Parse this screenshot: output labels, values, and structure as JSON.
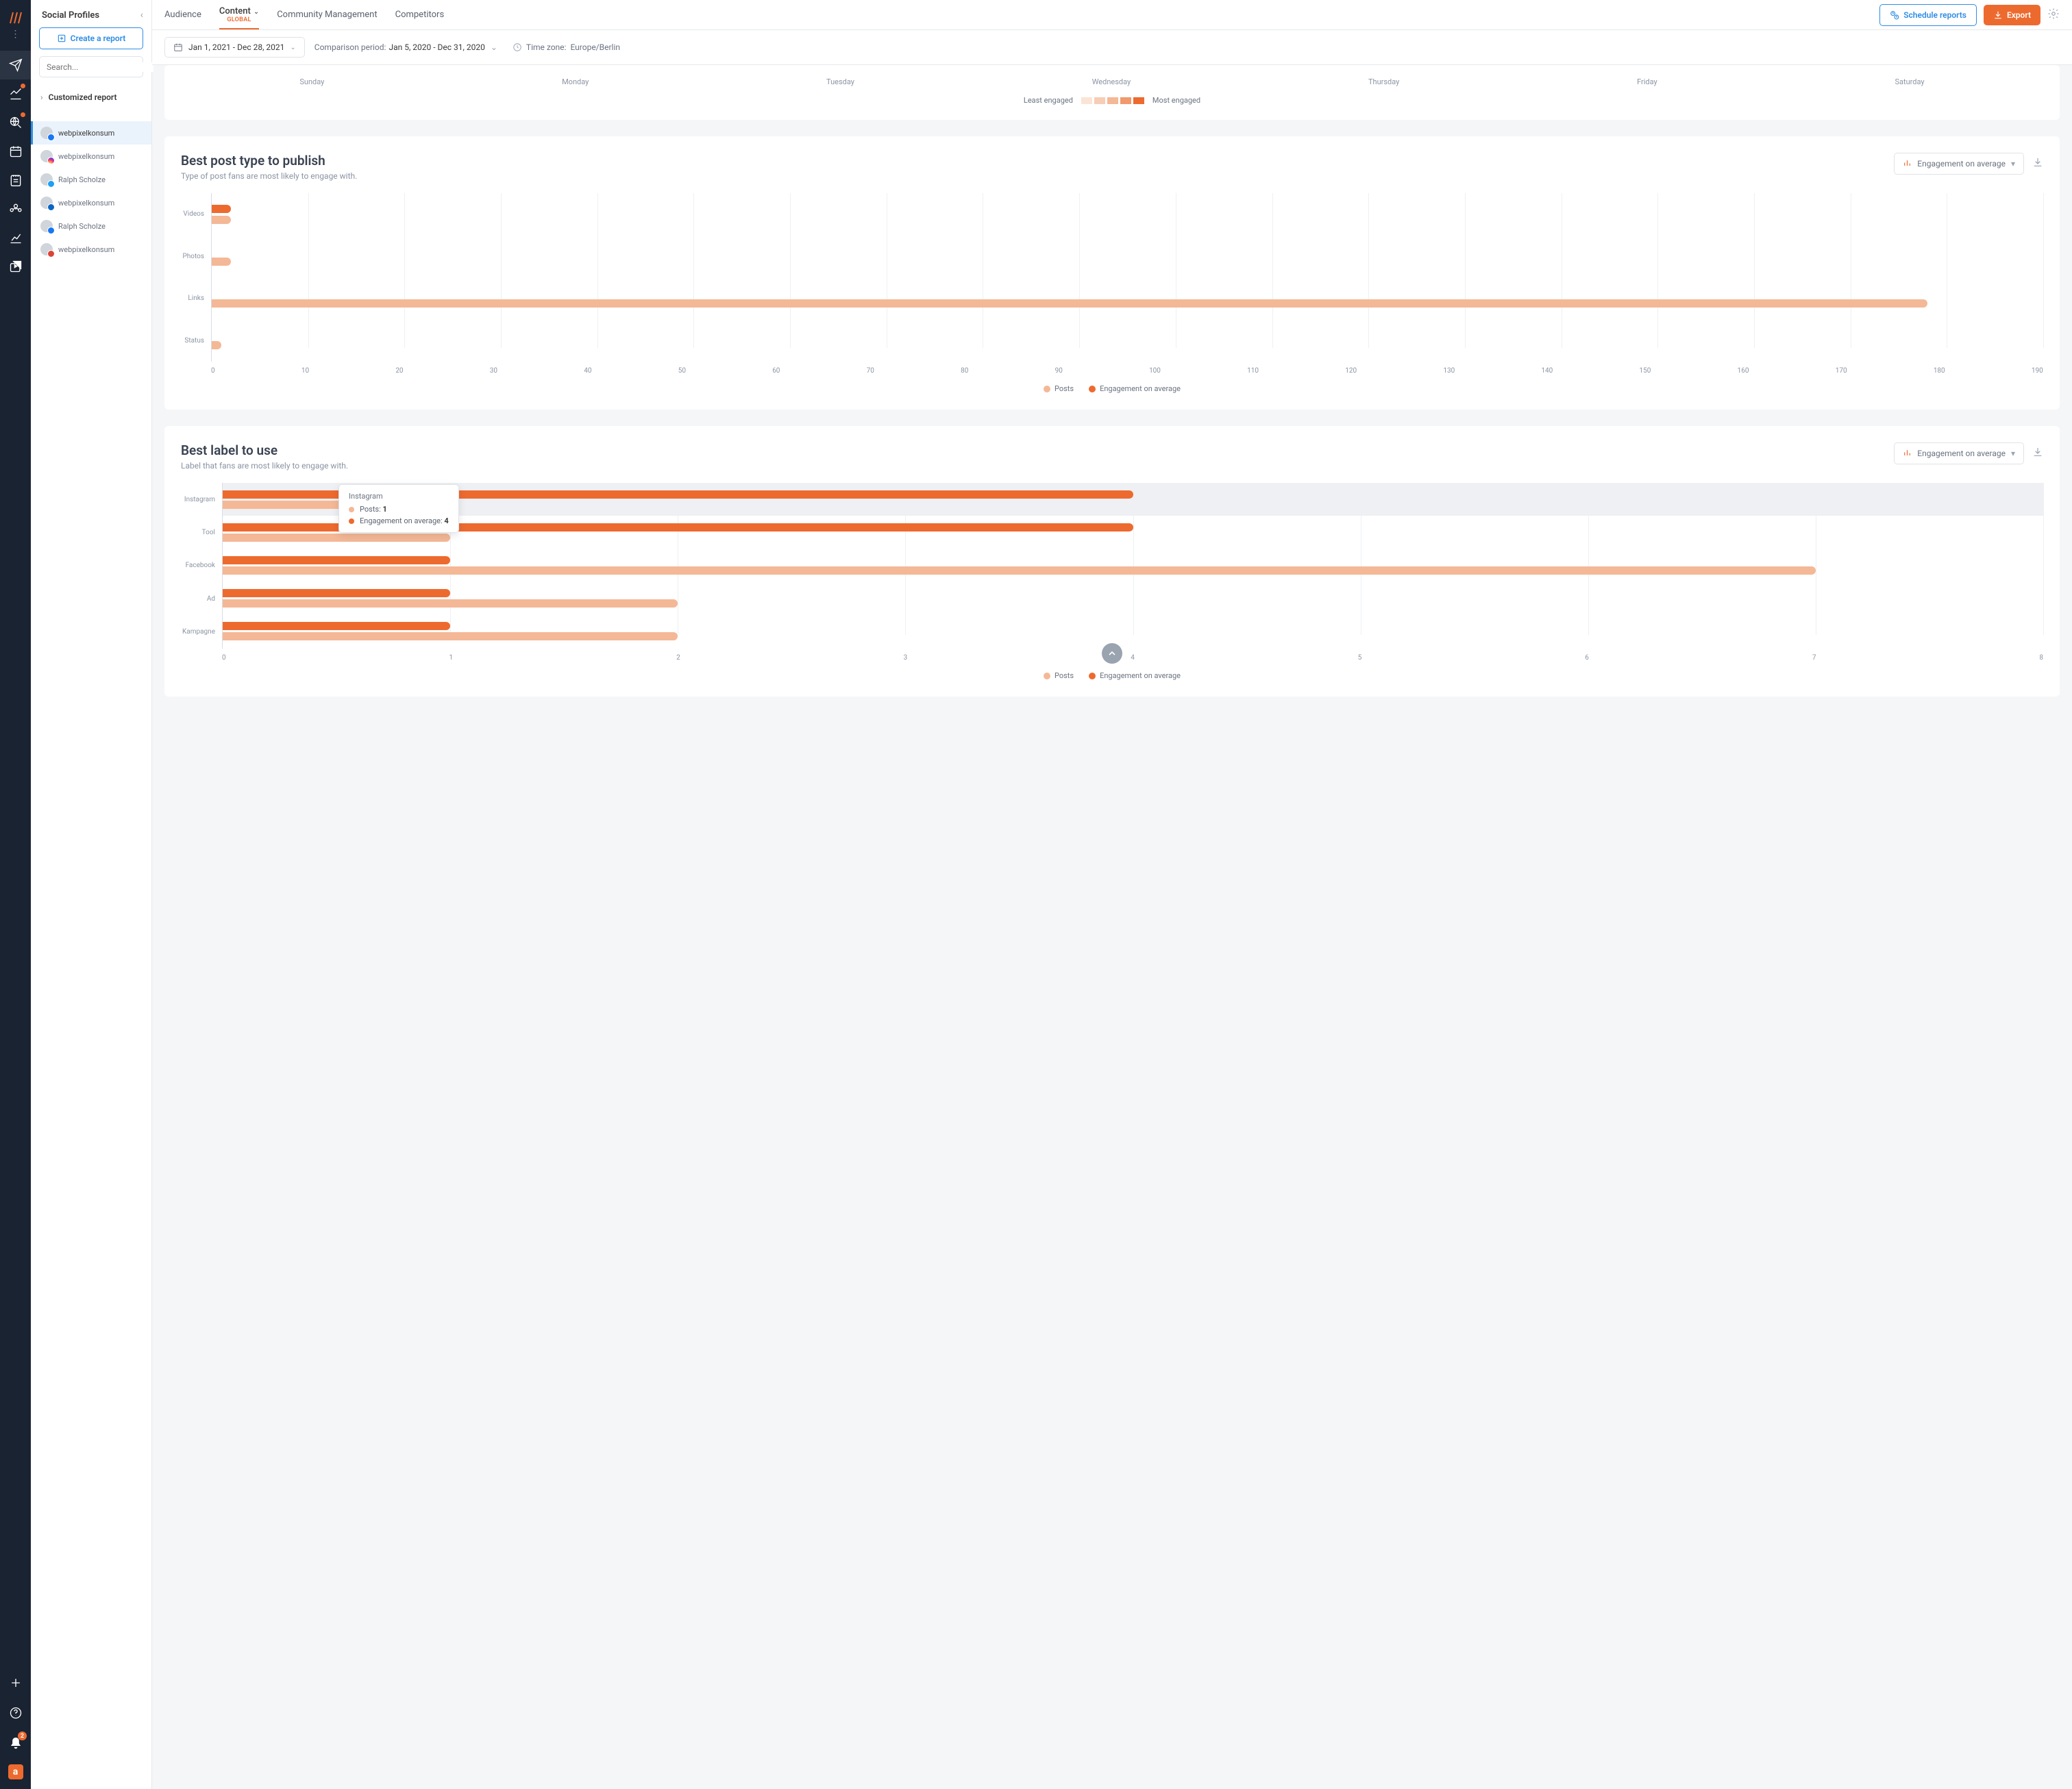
{
  "sidebar": {
    "title": "Social Profiles",
    "create": "Create a report",
    "search_placeholder": "Search...",
    "customized": "Customized report",
    "profiles": [
      {
        "name": "webpixelkonsum",
        "net": "fb",
        "active": true
      },
      {
        "name": "webpixelkonsum",
        "net": "ig"
      },
      {
        "name": "Ralph Scholze",
        "net": "tw"
      },
      {
        "name": "webpixelkonsum",
        "net": "li"
      },
      {
        "name": "Ralph Scholze",
        "net": "fp"
      },
      {
        "name": "webpixelkonsum",
        "net": "gp"
      }
    ]
  },
  "tabs": {
    "audience": "Audience",
    "content": "Content",
    "content_sub": "Global",
    "community": "Community Management",
    "competitors": "Competitors"
  },
  "actions": {
    "schedule": "Schedule reports",
    "export": "Export"
  },
  "filters": {
    "date_range": "Jan 1, 2021 - Dec 28, 2021",
    "comp_label": "Comparison period:",
    "comp_value": "Jan 5, 2020 - Dec 31, 2020",
    "tz_label": "Time zone:",
    "tz_value": "Europe/Berlin"
  },
  "days": [
    "Sunday",
    "Monday",
    "Tuesday",
    "Wednesday",
    "Thursday",
    "Friday",
    "Saturday"
  ],
  "heat_legend": {
    "least": "Least engaged",
    "most": "Most engaged",
    "colors": [
      "#fbe4d6",
      "#f7cdb5",
      "#f4b896",
      "#f09a6d",
      "#ed6a2f"
    ]
  },
  "rail_notifications": "2",
  "card1": {
    "title": "Best post type to publish",
    "subtitle": "Type of post fans are most likely to engage with.",
    "dropdown": "Engagement on average",
    "legend_posts": "Posts",
    "legend_eng": "Engagement on average"
  },
  "card2": {
    "title": "Best label to use",
    "subtitle": "Label that fans are most likely to engage with.",
    "dropdown": "Engagement on average",
    "legend_posts": "Posts",
    "legend_eng": "Engagement on average"
  },
  "tooltip": {
    "title": "Instagram",
    "row1_label": "Posts:",
    "row1_val": "1",
    "row2_label": "Engagement on average:",
    "row2_val": "4"
  },
  "chart_data": [
    {
      "type": "bar",
      "title": "Best post type to publish",
      "orientation": "horizontal",
      "categories": [
        "Videos",
        "Photos",
        "Links",
        "Status"
      ],
      "series": [
        {
          "name": "Posts",
          "values": [
            2,
            2,
            178,
            1
          ]
        },
        {
          "name": "Engagement on average",
          "values": [
            2,
            0,
            0,
            0
          ]
        }
      ],
      "xlabel": "",
      "ylabel": "",
      "x_ticks": [
        0,
        10,
        20,
        30,
        40,
        50,
        60,
        70,
        80,
        90,
        100,
        110,
        120,
        130,
        140,
        150,
        160,
        170,
        180,
        190
      ],
      "xlim": [
        0,
        190
      ]
    },
    {
      "type": "bar",
      "title": "Best label to use",
      "orientation": "horizontal",
      "categories": [
        "Instagram",
        "Tool",
        "Facebook",
        "Ad",
        "Kampagne"
      ],
      "series": [
        {
          "name": "Posts",
          "values": [
            1,
            1,
            7,
            2,
            2
          ]
        },
        {
          "name": "Engagement on average",
          "values": [
            4,
            4,
            1,
            1,
            1
          ]
        }
      ],
      "xlabel": "",
      "ylabel": "",
      "x_ticks": [
        0,
        1,
        2,
        3,
        4,
        5,
        6,
        7,
        8
      ],
      "xlim": [
        0,
        8
      ]
    }
  ]
}
